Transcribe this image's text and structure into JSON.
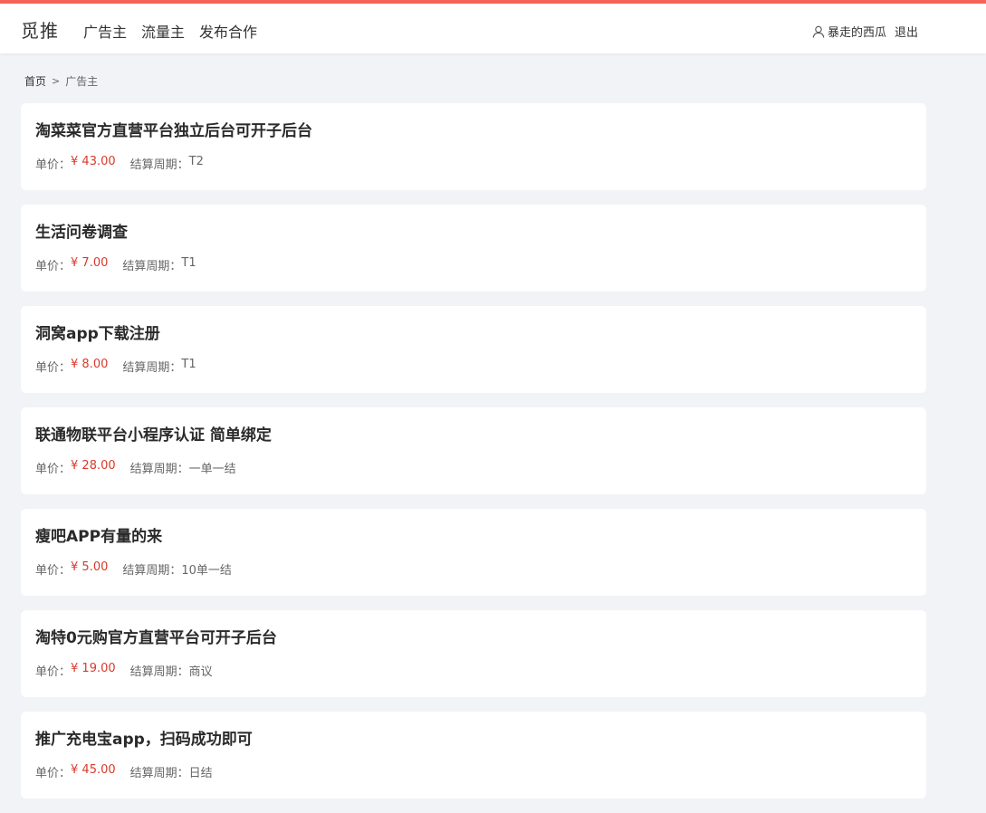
{
  "brand": {
    "logo_text": "觅推",
    "accent_color": "#f6635a",
    "price_color": "#d93a2b"
  },
  "nav": {
    "items": [
      "广告主",
      "流量主",
      "发布合作"
    ]
  },
  "user": {
    "icon": "user-icon",
    "name": "暴走的西瓜",
    "logout_label": "退出"
  },
  "breadcrumb": {
    "home": "首页",
    "separator": ">",
    "current": "广告主"
  },
  "labels": {
    "price": "单价：",
    "cycle": "结算周期："
  },
  "tasks": [
    {
      "title": "淘菜菜官方直营平台独立后台可开子后台",
      "price": "¥ 43.00",
      "cycle": "T2"
    },
    {
      "title": "生活问卷调查",
      "price": "¥ 7.00",
      "cycle": "T1"
    },
    {
      "title": "洞窝app下载注册",
      "price": "¥ 8.00",
      "cycle": "T1"
    },
    {
      "title": "联通物联平台小程序认证 简单绑定",
      "price": "¥ 28.00",
      "cycle": "一单一结"
    },
    {
      "title": "瘦吧APP有量的来",
      "price": "¥ 5.00",
      "cycle": "10单一结"
    },
    {
      "title": "淘特0元购官方直营平台可开子后台",
      "price": "¥ 19.00",
      "cycle": "商议"
    },
    {
      "title": "推广充电宝app，扫码成功即可",
      "price": "¥ 45.00",
      "cycle": "日结"
    }
  ]
}
